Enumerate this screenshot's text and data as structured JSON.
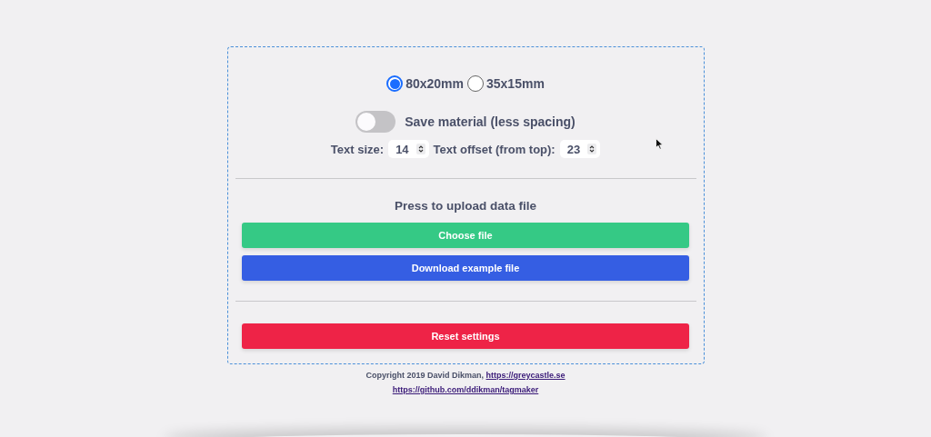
{
  "size_options": [
    {
      "label": "80x20mm",
      "selected": true
    },
    {
      "label": "35x15mm",
      "selected": false
    }
  ],
  "save_material": {
    "label": "Save material (less spacing)",
    "on": false
  },
  "number_fields": [
    {
      "label": "Text size:",
      "value": "14"
    },
    {
      "label": "Text offset (from top):",
      "value": "23"
    }
  ],
  "upload_heading": "Press to upload data file",
  "upload_buttons": [
    {
      "label": "Choose file",
      "color": "#35c985"
    },
    {
      "label": "Download example file",
      "color": "#355ee3"
    }
  ],
  "reset_button": {
    "label": "Reset settings",
    "color": "#ee2347"
  },
  "footer": {
    "copyright": "Copyright 2019 David Dikman,",
    "links": [
      "https://greycastle.se",
      "https://github.com/ddikman/tagmaker"
    ]
  }
}
